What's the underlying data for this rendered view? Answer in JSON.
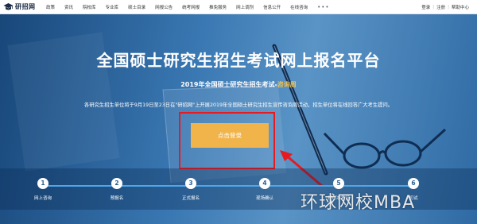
{
  "header": {
    "logo_text": "研招网",
    "nav": [
      "政策",
      "资讯",
      "院校库",
      "专业库",
      "硕士目录",
      "网报公告",
      "统考网报",
      "推免服务",
      "网上调剂",
      "信息公开",
      "在线咨询"
    ],
    "more": "•••",
    "user": {
      "login": "登录",
      "sep1": "|",
      "register": "注册",
      "sep2": "|",
      "help": "帮助中心"
    }
  },
  "hero": {
    "title": "全国硕士研究生招生考试网上报名平台",
    "subtitle_main": "2019年全国硕士研究生招生考试-",
    "subtitle_highlight": "咨询周",
    "description": "各研究生招生单位将于9月19日至23日在\"研招网\"上开展2019年全国硕士研究生招生宣传咨询周活动，招生单位将在线回答广大考生提问。",
    "login_button": "点击登录"
  },
  "steps": [
    {
      "num": "1",
      "label": "网上咨询"
    },
    {
      "num": "2",
      "label": "预报名"
    },
    {
      "num": "3",
      "label": "正式报名"
    },
    {
      "num": "4",
      "label": "现场确认"
    },
    {
      "num": "5",
      "label": "打印准考证"
    },
    {
      "num": "6",
      "label": "初试"
    }
  ],
  "watermark": "环球网校MBA",
  "colors": {
    "accent_button": "#f1b44a",
    "highlight": "#f3c34c",
    "annotation_red": "#e8191f",
    "track_blue": "#4fa7e8"
  }
}
